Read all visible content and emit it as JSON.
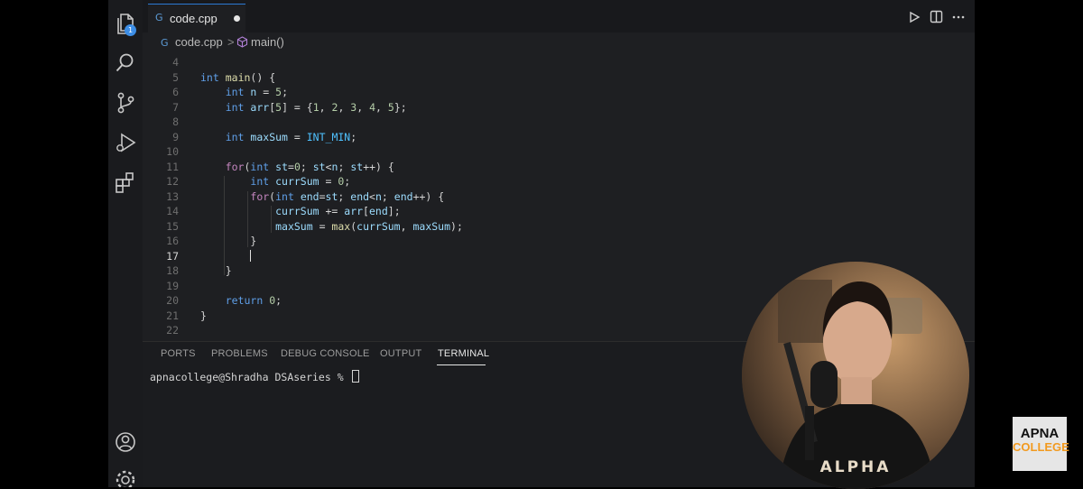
{
  "activity_bar": {
    "explorer_badge": "1",
    "icons": [
      "files-icon",
      "search-icon",
      "source-control-icon",
      "run-debug-icon",
      "extensions-icon",
      "account-icon",
      "settings-gear-icon"
    ]
  },
  "tab": {
    "filename": "code.cpp",
    "modified": true
  },
  "breadcrumb": {
    "file": "code.cpp",
    "separator": ">",
    "symbol": "main()"
  },
  "editor": {
    "active_line": 17,
    "lines": [
      {
        "n": "4",
        "code": ""
      },
      {
        "n": "5",
        "code": "int main() {"
      },
      {
        "n": "6",
        "code": "    int n = 5;"
      },
      {
        "n": "7",
        "code": "    int arr[5] = {1, 2, 3, 4, 5};"
      },
      {
        "n": "8",
        "code": ""
      },
      {
        "n": "9",
        "code": "    int maxSum = INT_MIN;"
      },
      {
        "n": "10",
        "code": ""
      },
      {
        "n": "11",
        "code": "    for(int st=0; st<n; st++) {"
      },
      {
        "n": "12",
        "code": "        int currSum = 0;"
      },
      {
        "n": "13",
        "code": "        for(int end=st; end<n; end++) {"
      },
      {
        "n": "14",
        "code": "            currSum += arr[end];"
      },
      {
        "n": "15",
        "code": "            maxSum = max(currSum, maxSum);"
      },
      {
        "n": "16",
        "code": "        }"
      },
      {
        "n": "17",
        "code": "        "
      },
      {
        "n": "18",
        "code": "    }"
      },
      {
        "n": "19",
        "code": ""
      },
      {
        "n": "20",
        "code": "    return 0;"
      },
      {
        "n": "21",
        "code": "}"
      },
      {
        "n": "22",
        "code": ""
      }
    ]
  },
  "panel": {
    "tabs": [
      "PORTS",
      "PROBLEMS",
      "DEBUG CONSOLE",
      "OUTPUT",
      "TERMINAL"
    ],
    "active_tab": "TERMINAL",
    "terminal_prompt": "apnacollege@Shradha DSAseries % "
  },
  "webcam": {
    "shirt_text": "ALPHA"
  },
  "logo": {
    "line1": "APNA",
    "line2": "COLLEGE"
  },
  "colors": {
    "accent": "#2b79d3",
    "keyword": "#5f9fe8",
    "function": "#dcdcaa",
    "variable": "#9cdcfe",
    "number": "#b5cea8",
    "logo_orange": "#f29a1f"
  }
}
